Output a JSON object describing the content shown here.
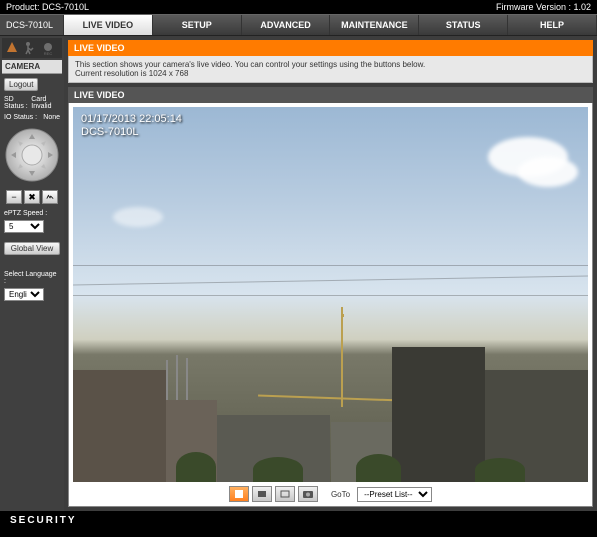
{
  "top": {
    "product_label": "Product: DCS-7010L",
    "firmware_label": "Firmware Version : 1.02"
  },
  "nav": {
    "device": "DCS-7010L",
    "tabs": [
      "LIVE VIDEO",
      "SETUP",
      "ADVANCED",
      "MAINTENANCE",
      "STATUS",
      "HELP"
    ]
  },
  "sidebar": {
    "camera_hdr": "CAMERA",
    "logout": "Logout",
    "sd_status_label": "SD Status :",
    "sd_status_value": "Card Invalid",
    "io_status_label": "IO Status :",
    "io_status_value": "None",
    "ptz_speed_label": "ePTZ Speed :",
    "ptz_speed_value": "5",
    "global_view": "Global View",
    "lang_label": "Select Language :",
    "lang_value": "English"
  },
  "content": {
    "title": "LIVE VIDEO",
    "desc_line1": "This section shows your camera's live video. You can control your settings using the buttons below.",
    "desc_line2": "Current resolution is 1024 x 768",
    "sub_title": "LIVE VIDEO",
    "osd_date": "01/17/2013 22:05:14",
    "osd_name": "DCS-7010L",
    "goto": "GoTo",
    "preset": "--Preset List--"
  },
  "footer": {
    "brand": "SECURITY"
  }
}
